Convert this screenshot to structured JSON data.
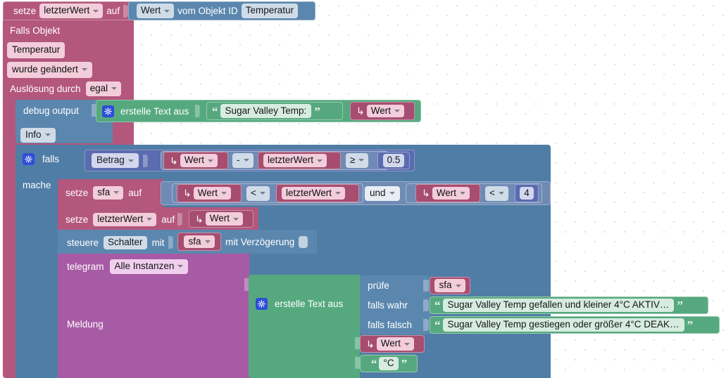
{
  "app": {
    "type": "blockly-visual-script",
    "language": "de"
  },
  "colors": {
    "pink": "#b3577c",
    "blue": "#5b87ae",
    "green": "#56a97f",
    "purple": "#a85ba5",
    "navy": "#5b6bb0",
    "steel": "#6f8bb5",
    "workspace_bg": "#ffffff",
    "grid_dot": "#d8d8de"
  },
  "blocks": {
    "set_lastvalue_top": {
      "keyword": "setze",
      "variable": "letzterWert",
      "connector": "auf"
    },
    "get_state": {
      "field": "Wert",
      "label": "vom Objekt ID",
      "object_id": "Temperatur"
    },
    "trigger": {
      "title": "Falls Objekt",
      "object": "Temperatur",
      "condition": "wurde geändert",
      "source_label": "Auslösung durch",
      "source_value": "egal"
    },
    "debug": {
      "label": "debug output",
      "severity": "Info"
    },
    "debug_text": {
      "label": "erstelle Text aus",
      "gear_icon": "gear-icon",
      "string1": "Sugar Valley Temp:",
      "value2": "Wert"
    },
    "if_block": {
      "gear_icon": "gear-icon",
      "if_label": "falls",
      "do_label": "mache"
    },
    "condition": {
      "math_op": "Betrag",
      "operand_a": "Wert",
      "minus_op": "-",
      "operand_b": "letzterWert",
      "compare_op": "≥",
      "number": "0.5"
    },
    "set_sfa": {
      "keyword": "setze",
      "variable": "sfa",
      "connector": "auf"
    },
    "logic": {
      "left_a": "Wert",
      "left_op": "<",
      "left_b": "letzterWert",
      "join_op": "und",
      "right_a": "Wert",
      "right_op": "<",
      "right_b": "4"
    },
    "set_lastvalue_inner": {
      "keyword": "setze",
      "variable": "letzterWert",
      "connector": "auf",
      "value": "Wert"
    },
    "control": {
      "keyword": "steuere",
      "object": "Schalter",
      "with_label": "mit",
      "value": "sfa",
      "delay_label": "mit Verzögerung",
      "delay_value": ""
    },
    "telegram": {
      "label": "telegram",
      "instance": "Alle Instanzen",
      "message_label": "Meldung"
    },
    "message_text": {
      "label": "erstelle Text aus",
      "gear_icon": "gear-icon"
    },
    "ternary": {
      "test_label": "prüfe",
      "test_value": "sfa",
      "true_label": "falls wahr",
      "true_value": "Sugar Valley Temp gefallen und kleiner 4°C AKTIV…",
      "false_label": "falls falsch",
      "false_value": "Sugar Valley Temp gestiegen oder größer 4°C DEAK…"
    },
    "message_tail": {
      "value": "Wert",
      "unit": "°C"
    }
  }
}
